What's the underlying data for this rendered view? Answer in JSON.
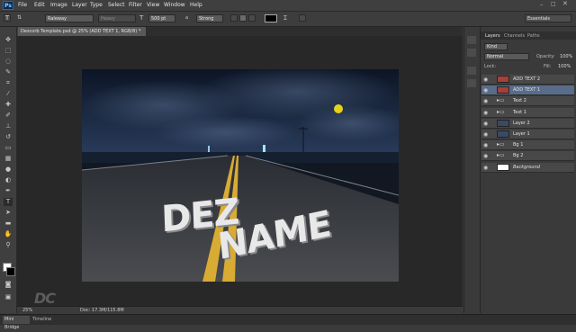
{
  "app": {
    "logo": "Ps"
  },
  "menu": [
    "File",
    "Edit",
    "Image",
    "Layer",
    "Type",
    "Select",
    "Filter",
    "View",
    "Window",
    "Help"
  ],
  "options": {
    "font_family": "Raleway",
    "font_style": "Heavy",
    "font_size": "500 pt",
    "antialias_label": "a",
    "antialias": "Strong",
    "workspace": "Essentials",
    "text_color": "#000000"
  },
  "document": {
    "tab_title": "Dezcorb Template.psd @ 25% (ADD TEXT 1, RGB/8) *",
    "line1": "DEZ",
    "line2": "NAME"
  },
  "status": {
    "zoom": "25%",
    "doc": "Doc: 17.3M/115.8M"
  },
  "bottom_tabs": [
    "Mini Bridge",
    "Timeline"
  ],
  "watermark": "DC",
  "layers_panel": {
    "tabs": [
      "Layers",
      "Channels",
      "Paths"
    ],
    "filter": "Kind",
    "blend_mode": "Normal",
    "opacity_label": "Opacity:",
    "opacity": "100%",
    "lock_label": "Lock:",
    "fill_label": "Fill:",
    "fill": "100%",
    "layers": [
      {
        "name": "ADD TEXT 2",
        "type": "smart",
        "selected": false
      },
      {
        "name": "ADD TEXT 1",
        "type": "smart",
        "selected": true
      },
      {
        "name": "Text 2",
        "type": "group",
        "selected": false
      },
      {
        "name": "Text 1",
        "type": "group",
        "selected": false
      },
      {
        "name": "Layer 2",
        "type": "image",
        "selected": false
      },
      {
        "name": "Layer 1",
        "type": "image",
        "selected": false
      },
      {
        "name": "Bg 1",
        "type": "group",
        "selected": false
      },
      {
        "name": "Bg 2",
        "type": "group",
        "selected": false
      },
      {
        "name": "Background",
        "type": "fill",
        "selected": false
      }
    ]
  },
  "colors": {
    "accent": "#596c8a",
    "chrome": "#3f3f3f",
    "canvas_bg": "#282828",
    "road_line": "#e0b43a"
  }
}
